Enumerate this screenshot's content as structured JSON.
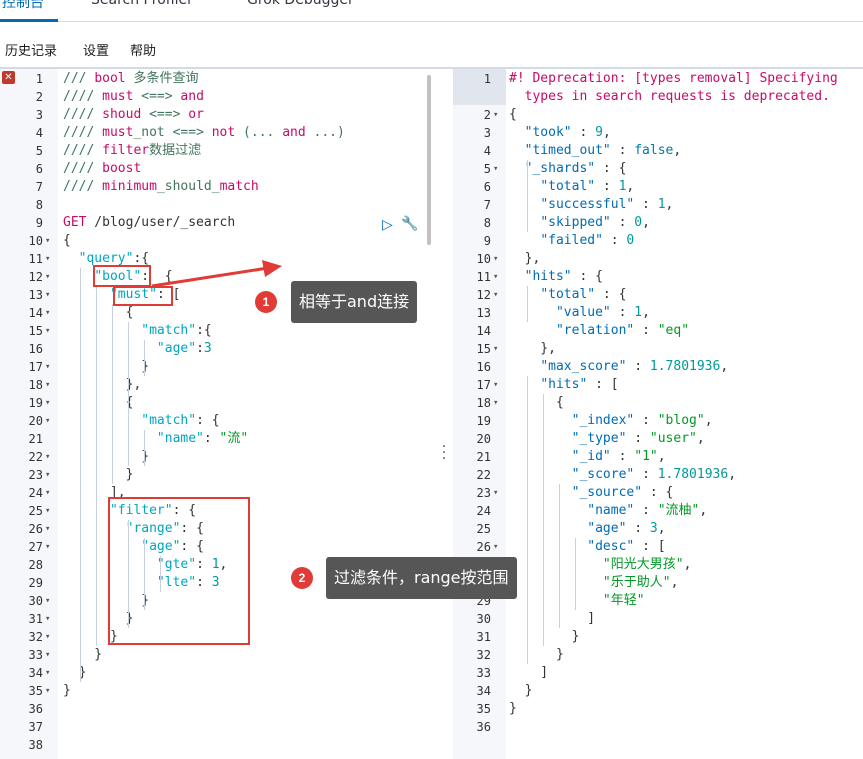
{
  "top_tabs": [
    "控制台",
    "Search Profiler",
    "Grok Debugger"
  ],
  "menu": [
    "历史记录",
    "设置",
    "帮助"
  ],
  "left_editor": {
    "lines": [
      [
        [
          "t-comment",
          "/// "
        ],
        [
          "t-red",
          "bool"
        ],
        [
          "t-comment",
          " 多条件查询"
        ]
      ],
      [
        [
          "t-comment",
          "//// "
        ],
        [
          "t-red",
          "must"
        ],
        [
          "t-comment",
          " <==> "
        ],
        [
          "t-red",
          "and"
        ]
      ],
      [
        [
          "t-comment",
          "//// "
        ],
        [
          "t-red",
          "shoud"
        ],
        [
          "t-comment",
          " <==> "
        ],
        [
          "t-red",
          "or"
        ]
      ],
      [
        [
          "t-comment",
          "//// "
        ],
        [
          "t-red",
          "must"
        ],
        [
          "t-comment",
          "_not <==> "
        ],
        [
          "t-red",
          "not"
        ],
        [
          "t-comment",
          " (... "
        ],
        [
          "t-red",
          "and"
        ],
        [
          "t-comment",
          " ...)"
        ]
      ],
      [
        [
          "t-comment",
          "//// "
        ],
        [
          "t-red",
          "filter"
        ],
        [
          "t-comment",
          "数据过滤"
        ]
      ],
      [
        [
          "t-comment",
          "//// "
        ],
        [
          "t-red",
          "boost"
        ]
      ],
      [
        [
          "t-comment",
          "//// "
        ],
        [
          "t-red",
          "minimum"
        ],
        [
          "t-comment",
          "_should_"
        ],
        [
          "t-red",
          "match"
        ]
      ],
      [],
      [
        [
          "t-method",
          "GET"
        ],
        [
          "t-path",
          " /blog/user/_search"
        ]
      ],
      [
        [
          "t-punct",
          "{"
        ]
      ],
      [
        [
          "t-punct",
          "  "
        ],
        [
          "t-key",
          "\"query\""
        ],
        [
          "t-punct",
          ":{"
        ]
      ],
      [
        [
          "t-punct",
          "    "
        ],
        [
          "t-key",
          "\"bool\""
        ],
        [
          "t-punct",
          ":  {"
        ]
      ],
      [
        [
          "t-punct",
          "      "
        ],
        [
          "t-key",
          "\"must\""
        ],
        [
          "t-punct",
          ": ["
        ]
      ],
      [
        [
          "t-punct",
          "        {"
        ]
      ],
      [
        [
          "t-punct",
          "          "
        ],
        [
          "t-key",
          "\"match\""
        ],
        [
          "t-punct",
          ":{"
        ]
      ],
      [
        [
          "t-punct",
          "            "
        ],
        [
          "t-key",
          "\"age\""
        ],
        [
          "t-punct",
          ":"
        ],
        [
          "t-num",
          "3"
        ]
      ],
      [
        [
          "t-punct",
          "          }"
        ]
      ],
      [
        [
          "t-punct",
          "        },"
        ]
      ],
      [
        [
          "t-punct",
          "        {"
        ]
      ],
      [
        [
          "t-punct",
          "          "
        ],
        [
          "t-key",
          "\"match\""
        ],
        [
          "t-punct",
          ": {"
        ]
      ],
      [
        [
          "t-punct",
          "            "
        ],
        [
          "t-key",
          "\"name\""
        ],
        [
          "t-punct",
          ": "
        ],
        [
          "t-str",
          "\"流\""
        ]
      ],
      [
        [
          "t-punct",
          "          }"
        ]
      ],
      [
        [
          "t-punct",
          "        }"
        ]
      ],
      [
        [
          "t-punct",
          "      ],"
        ]
      ],
      [
        [
          "t-punct",
          "      "
        ],
        [
          "t-key",
          "\"filter\""
        ],
        [
          "t-punct",
          ": {"
        ]
      ],
      [
        [
          "t-punct",
          "        "
        ],
        [
          "t-key",
          "\"range\""
        ],
        [
          "t-punct",
          ": {"
        ]
      ],
      [
        [
          "t-punct",
          "          "
        ],
        [
          "t-key",
          "\"age\""
        ],
        [
          "t-punct",
          ": {"
        ]
      ],
      [
        [
          "t-punct",
          "            "
        ],
        [
          "t-key",
          "\"gte\""
        ],
        [
          "t-punct",
          ": "
        ],
        [
          "t-num",
          "1"
        ],
        [
          "t-punct",
          ","
        ]
      ],
      [
        [
          "t-punct",
          "            "
        ],
        [
          "t-key",
          "\"lte\""
        ],
        [
          "t-punct",
          ": "
        ],
        [
          "t-num",
          "3"
        ]
      ],
      [
        [
          "t-punct",
          "          }"
        ]
      ],
      [
        [
          "t-punct",
          "        }"
        ]
      ],
      [
        [
          "t-punct",
          "      }"
        ]
      ],
      [
        [
          "t-punct",
          "    }"
        ]
      ],
      [
        [
          "t-punct",
          "  }"
        ]
      ],
      [
        [
          "t-punct",
          "}"
        ]
      ],
      [],
      [],
      []
    ],
    "folds": [
      10,
      11,
      12,
      13,
      14,
      15,
      17,
      18,
      19,
      20,
      22,
      23,
      24,
      25,
      26,
      27,
      30,
      31,
      32,
      33,
      34,
      35
    ]
  },
  "right_editor": {
    "rows": [
      {
        "n": "1",
        "code": [
          [
            "t-warn",
            "#! Deprecation: [types removal] Specifying"
          ]
        ]
      },
      {
        "n": "",
        "code": [
          [
            "t-warn",
            "  types in search requests is deprecated."
          ]
        ]
      },
      {
        "n": "2",
        "code": [
          [
            "t-punct",
            "{"
          ]
        ]
      },
      {
        "n": "3",
        "code": [
          [
            "t-punct",
            "  "
          ],
          [
            "t-key2",
            "\"took\""
          ],
          [
            "t-punct",
            " : "
          ],
          [
            "t-num",
            "9"
          ],
          [
            "t-punct",
            ","
          ]
        ]
      },
      {
        "n": "4",
        "code": [
          [
            "t-punct",
            "  "
          ],
          [
            "t-key2",
            "\"timed_out\""
          ],
          [
            "t-punct",
            " : "
          ],
          [
            "t-kw-blue",
            "false"
          ],
          [
            "t-punct",
            ","
          ]
        ]
      },
      {
        "n": "5",
        "code": [
          [
            "t-punct",
            "  "
          ],
          [
            "t-key2",
            "\"_shards\""
          ],
          [
            "t-punct",
            " : {"
          ]
        ]
      },
      {
        "n": "6",
        "code": [
          [
            "t-punct",
            "    "
          ],
          [
            "t-key2",
            "\"total\""
          ],
          [
            "t-punct",
            " : "
          ],
          [
            "t-num",
            "1"
          ],
          [
            "t-punct",
            ","
          ]
        ]
      },
      {
        "n": "7",
        "code": [
          [
            "t-punct",
            "    "
          ],
          [
            "t-key2",
            "\"successful\""
          ],
          [
            "t-punct",
            " : "
          ],
          [
            "t-num",
            "1"
          ],
          [
            "t-punct",
            ","
          ]
        ]
      },
      {
        "n": "8",
        "code": [
          [
            "t-punct",
            "    "
          ],
          [
            "t-key2",
            "\"skipped\""
          ],
          [
            "t-punct",
            " : "
          ],
          [
            "t-num",
            "0"
          ],
          [
            "t-punct",
            ","
          ]
        ]
      },
      {
        "n": "9",
        "code": [
          [
            "t-punct",
            "    "
          ],
          [
            "t-key2",
            "\"failed\""
          ],
          [
            "t-punct",
            " : "
          ],
          [
            "t-num",
            "0"
          ]
        ]
      },
      {
        "n": "10",
        "code": [
          [
            "t-punct",
            "  },"
          ]
        ]
      },
      {
        "n": "11",
        "code": [
          [
            "t-punct",
            "  "
          ],
          [
            "t-key2",
            "\"hits\""
          ],
          [
            "t-punct",
            " : {"
          ]
        ]
      },
      {
        "n": "12",
        "code": [
          [
            "t-punct",
            "    "
          ],
          [
            "t-key2",
            "\"total\""
          ],
          [
            "t-punct",
            " : {"
          ]
        ]
      },
      {
        "n": "13",
        "code": [
          [
            "t-punct",
            "      "
          ],
          [
            "t-key2",
            "\"value\""
          ],
          [
            "t-punct",
            " : "
          ],
          [
            "t-num",
            "1"
          ],
          [
            "t-punct",
            ","
          ]
        ]
      },
      {
        "n": "14",
        "code": [
          [
            "t-punct",
            "      "
          ],
          [
            "t-key2",
            "\"relation\""
          ],
          [
            "t-punct",
            " : "
          ],
          [
            "t-str",
            "\"eq\""
          ]
        ]
      },
      {
        "n": "15",
        "code": [
          [
            "t-punct",
            "    },"
          ]
        ]
      },
      {
        "n": "16",
        "code": [
          [
            "t-punct",
            "    "
          ],
          [
            "t-key2",
            "\"max_score\""
          ],
          [
            "t-punct",
            " : "
          ],
          [
            "t-num",
            "1.7801936"
          ],
          [
            "t-punct",
            ","
          ]
        ]
      },
      {
        "n": "17",
        "code": [
          [
            "t-punct",
            "    "
          ],
          [
            "t-key2",
            "\"hits\""
          ],
          [
            "t-punct",
            " : ["
          ]
        ]
      },
      {
        "n": "18",
        "code": [
          [
            "t-punct",
            "      {"
          ]
        ]
      },
      {
        "n": "19",
        "code": [
          [
            "t-punct",
            "        "
          ],
          [
            "t-key2",
            "\"_index\""
          ],
          [
            "t-punct",
            " : "
          ],
          [
            "t-str",
            "\"blog\""
          ],
          [
            "t-punct",
            ","
          ]
        ]
      },
      {
        "n": "20",
        "code": [
          [
            "t-punct",
            "        "
          ],
          [
            "t-key2",
            "\"_type\""
          ],
          [
            "t-punct",
            " : "
          ],
          [
            "t-str",
            "\"user\""
          ],
          [
            "t-punct",
            ","
          ]
        ]
      },
      {
        "n": "21",
        "code": [
          [
            "t-punct",
            "        "
          ],
          [
            "t-key2",
            "\"_id\""
          ],
          [
            "t-punct",
            " : "
          ],
          [
            "t-str",
            "\"1\""
          ],
          [
            "t-punct",
            ","
          ]
        ]
      },
      {
        "n": "22",
        "code": [
          [
            "t-punct",
            "        "
          ],
          [
            "t-key2",
            "\"_score\""
          ],
          [
            "t-punct",
            " : "
          ],
          [
            "t-num",
            "1.7801936"
          ],
          [
            "t-punct",
            ","
          ]
        ]
      },
      {
        "n": "23",
        "code": [
          [
            "t-punct",
            "        "
          ],
          [
            "t-key2",
            "\"_source\""
          ],
          [
            "t-punct",
            " : {"
          ]
        ]
      },
      {
        "n": "24",
        "code": [
          [
            "t-punct",
            "          "
          ],
          [
            "t-key2",
            "\"name\""
          ],
          [
            "t-punct",
            " : "
          ],
          [
            "t-str",
            "\"流柚\""
          ],
          [
            "t-punct",
            ","
          ]
        ]
      },
      {
        "n": "25",
        "code": [
          [
            "t-punct",
            "          "
          ],
          [
            "t-key2",
            "\"age\""
          ],
          [
            "t-punct",
            " : "
          ],
          [
            "t-num",
            "3"
          ],
          [
            "t-punct",
            ","
          ]
        ]
      },
      {
        "n": "26",
        "code": [
          [
            "t-punct",
            "          "
          ],
          [
            "t-key2",
            "\"desc\""
          ],
          [
            "t-punct",
            " : ["
          ]
        ]
      },
      {
        "n": "27",
        "code": [
          [
            "t-punct",
            "            "
          ],
          [
            "t-str",
            "\"阳光大男孩\""
          ],
          [
            "t-punct",
            ","
          ]
        ]
      },
      {
        "n": "28",
        "code": [
          [
            "t-punct",
            "            "
          ],
          [
            "t-str",
            "\"乐于助人\""
          ],
          [
            "t-punct",
            ","
          ]
        ]
      },
      {
        "n": "29",
        "code": [
          [
            "t-punct",
            "            "
          ],
          [
            "t-str",
            "\"年轻\""
          ]
        ]
      },
      {
        "n": "30",
        "code": [
          [
            "t-punct",
            "          ]"
          ]
        ]
      },
      {
        "n": "31",
        "code": [
          [
            "t-punct",
            "        }"
          ]
        ]
      },
      {
        "n": "32",
        "code": [
          [
            "t-punct",
            "      }"
          ]
        ]
      },
      {
        "n": "33",
        "code": [
          [
            "t-punct",
            "    ]"
          ]
        ]
      },
      {
        "n": "34",
        "code": [
          [
            "t-punct",
            "  }"
          ]
        ]
      },
      {
        "n": "35",
        "code": [
          [
            "t-punct",
            "}"
          ]
        ]
      },
      {
        "n": "36",
        "code": []
      }
    ],
    "folds": [
      "2",
      "5",
      "10",
      "11",
      "12",
      "15",
      "17",
      "18",
      "23",
      "26"
    ]
  },
  "annotations": {
    "note1_num": "1",
    "note1_text": "相等于and连接",
    "note2_num": "2",
    "note2_text": "过滤条件，range按范围"
  },
  "icons": {
    "error": "error-icon",
    "run": "play-icon",
    "wrench": "wrench-icon",
    "resize": "drag-handle-icon"
  },
  "colors": {
    "accent": "#006bb4",
    "annotation_red": "#e03b36",
    "callout_bg": "#565656"
  }
}
